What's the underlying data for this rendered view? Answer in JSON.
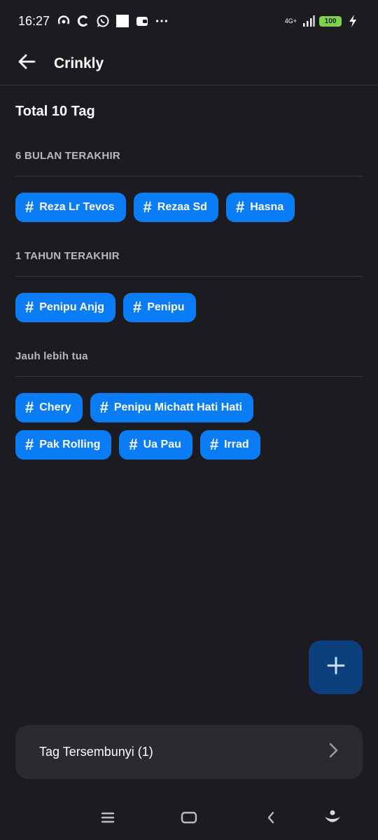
{
  "status_bar": {
    "time": "16:27",
    "network": "4G+",
    "battery": "100"
  },
  "app_bar": {
    "title": "Crinkly"
  },
  "total_label": "Total 10 Tag",
  "sections": [
    {
      "label": "6 BULAN TERAKHIR",
      "tags": [
        "Reza Lr Tevos",
        "Rezaa Sd",
        "Hasna"
      ]
    },
    {
      "label": "1 TAHUN TERAKHIR",
      "tags": [
        "Penipu Anjg",
        "Penipu"
      ]
    },
    {
      "label": "Jauh lebih tua",
      "tags": [
        "Chery",
        "Penipu Michatt Hati Hati",
        "Pak Rolling",
        "Ua Pau",
        "Irrad"
      ]
    }
  ],
  "hidden_tags": {
    "label": "Tag Tersembunyi (1)"
  },
  "colors": {
    "background": "#1c1b20",
    "chip": "#0a7cf5",
    "fab": "#0b3f7e",
    "card": "#2b2a30"
  }
}
